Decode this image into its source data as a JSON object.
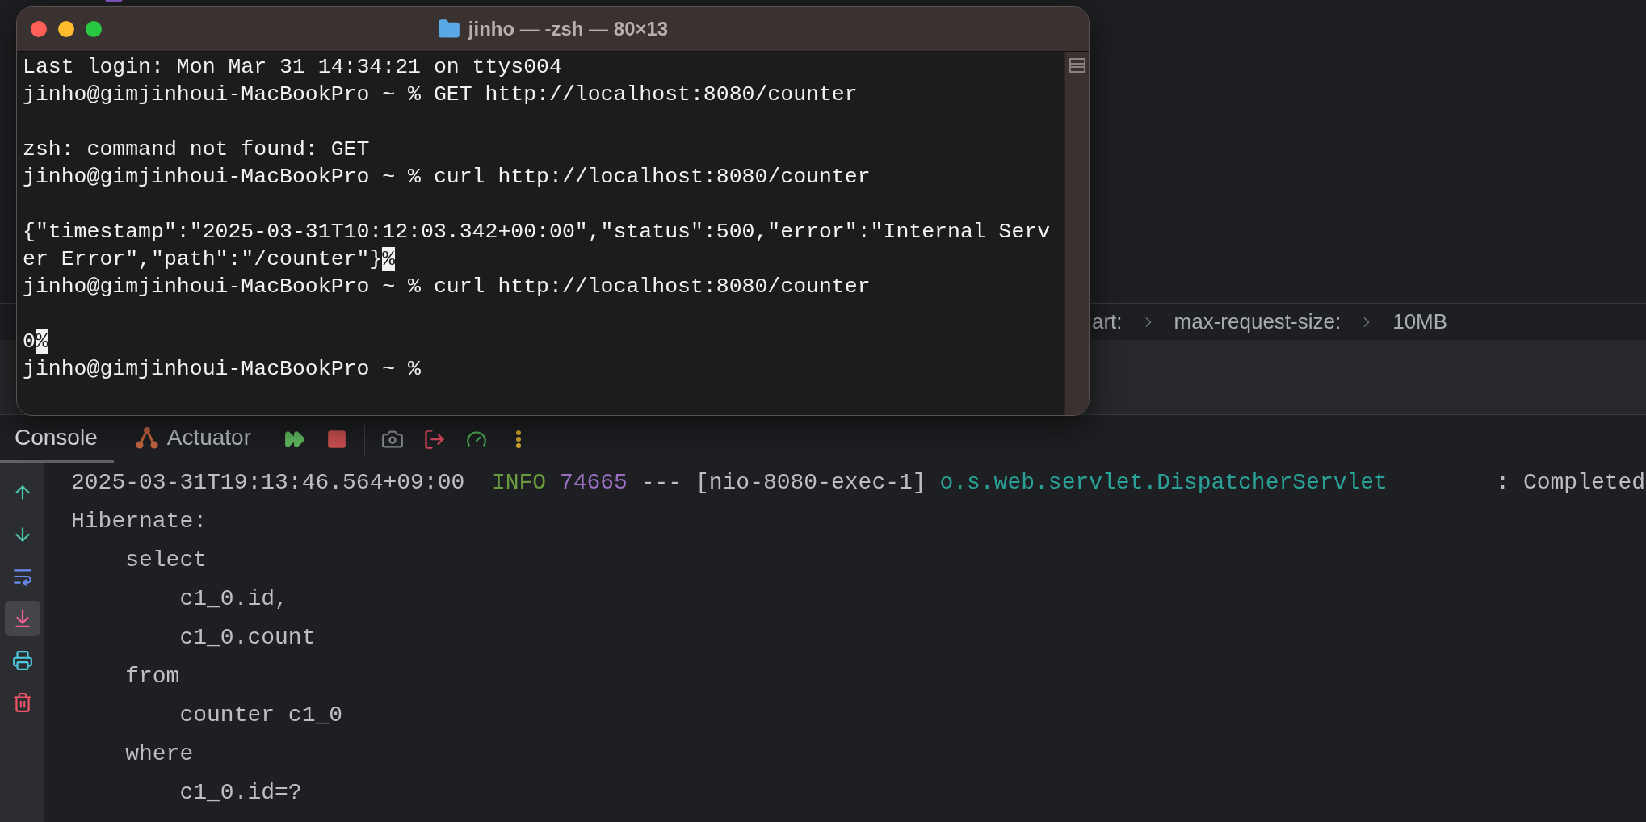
{
  "breadcrumbs": [
    "art:",
    "max-request-size:",
    "10MB"
  ],
  "terminal": {
    "title": "jinho — -zsh — 80×13",
    "lines": [
      {
        "kind": "text",
        "text": "Last login: Mon Mar 31 14:34:21 on ttys004"
      },
      {
        "kind": "text",
        "text": "jinho@gimjinhoui-MacBookPro ~ % GET http://localhost:8080/counter"
      },
      {
        "kind": "blank"
      },
      {
        "kind": "text",
        "text": "zsh: command not found: GET"
      },
      {
        "kind": "text",
        "text": "jinho@gimjinhoui-MacBookPro ~ % curl http://localhost:8080/counter"
      },
      {
        "kind": "blank"
      },
      {
        "kind": "text",
        "text": "{\"timestamp\":\"2025-03-31T10:12:03.342+00:00\",\"status\":500,\"error\":\"Internal Serv"
      },
      {
        "kind": "text",
        "text": "er Error\",\"path\":\"/counter\"}",
        "mark": "%"
      },
      {
        "kind": "text",
        "text": "jinho@gimjinhoui-MacBookPro ~ % curl http://localhost:8080/counter"
      },
      {
        "kind": "blank"
      },
      {
        "kind": "text",
        "text": "0",
        "mark": "%"
      },
      {
        "kind": "text",
        "text": "jinho@gimjinhoui-MacBookPro ~ %"
      }
    ]
  },
  "tool_window": {
    "tabs": [
      {
        "label": "Console",
        "selected": true,
        "kind": "plain"
      },
      {
        "label": "Actuator",
        "selected": false,
        "kind": "actuator"
      }
    ],
    "actions": [
      {
        "kind": "rerun"
      },
      {
        "kind": "stop"
      },
      {
        "kind": "divider"
      },
      {
        "kind": "camera"
      },
      {
        "kind": "exit"
      },
      {
        "kind": "gauge"
      },
      {
        "kind": "more"
      }
    ],
    "gutter": [
      {
        "kind": "up",
        "selected": false
      },
      {
        "kind": "down",
        "selected": false
      },
      {
        "kind": "wrap",
        "selected": false
      },
      {
        "kind": "scroll-end",
        "selected": true
      },
      {
        "kind": "print",
        "selected": false
      },
      {
        "kind": "clear",
        "selected": false
      }
    ],
    "log_line": [
      {
        "kind": "plain",
        "text": "2025-03-31T19:13:46.564+09:00  "
      },
      {
        "kind": "level",
        "text": "INFO"
      },
      {
        "kind": "pid",
        "text": " 74665"
      },
      {
        "kind": "plain",
        "text": " --- [nio-8080-exec-1] "
      },
      {
        "kind": "logger",
        "text": "o.s.web.servlet.DispatcherServlet"
      },
      {
        "kind": "plain",
        "text": "        : Completed"
      }
    ],
    "lines": [
      "Hibernate:",
      "    select",
      "        c1_0.id,",
      "        c1_0.count",
      "    from",
      "        counter c1_0",
      "    where",
      "        c1_0.id=?"
    ]
  }
}
